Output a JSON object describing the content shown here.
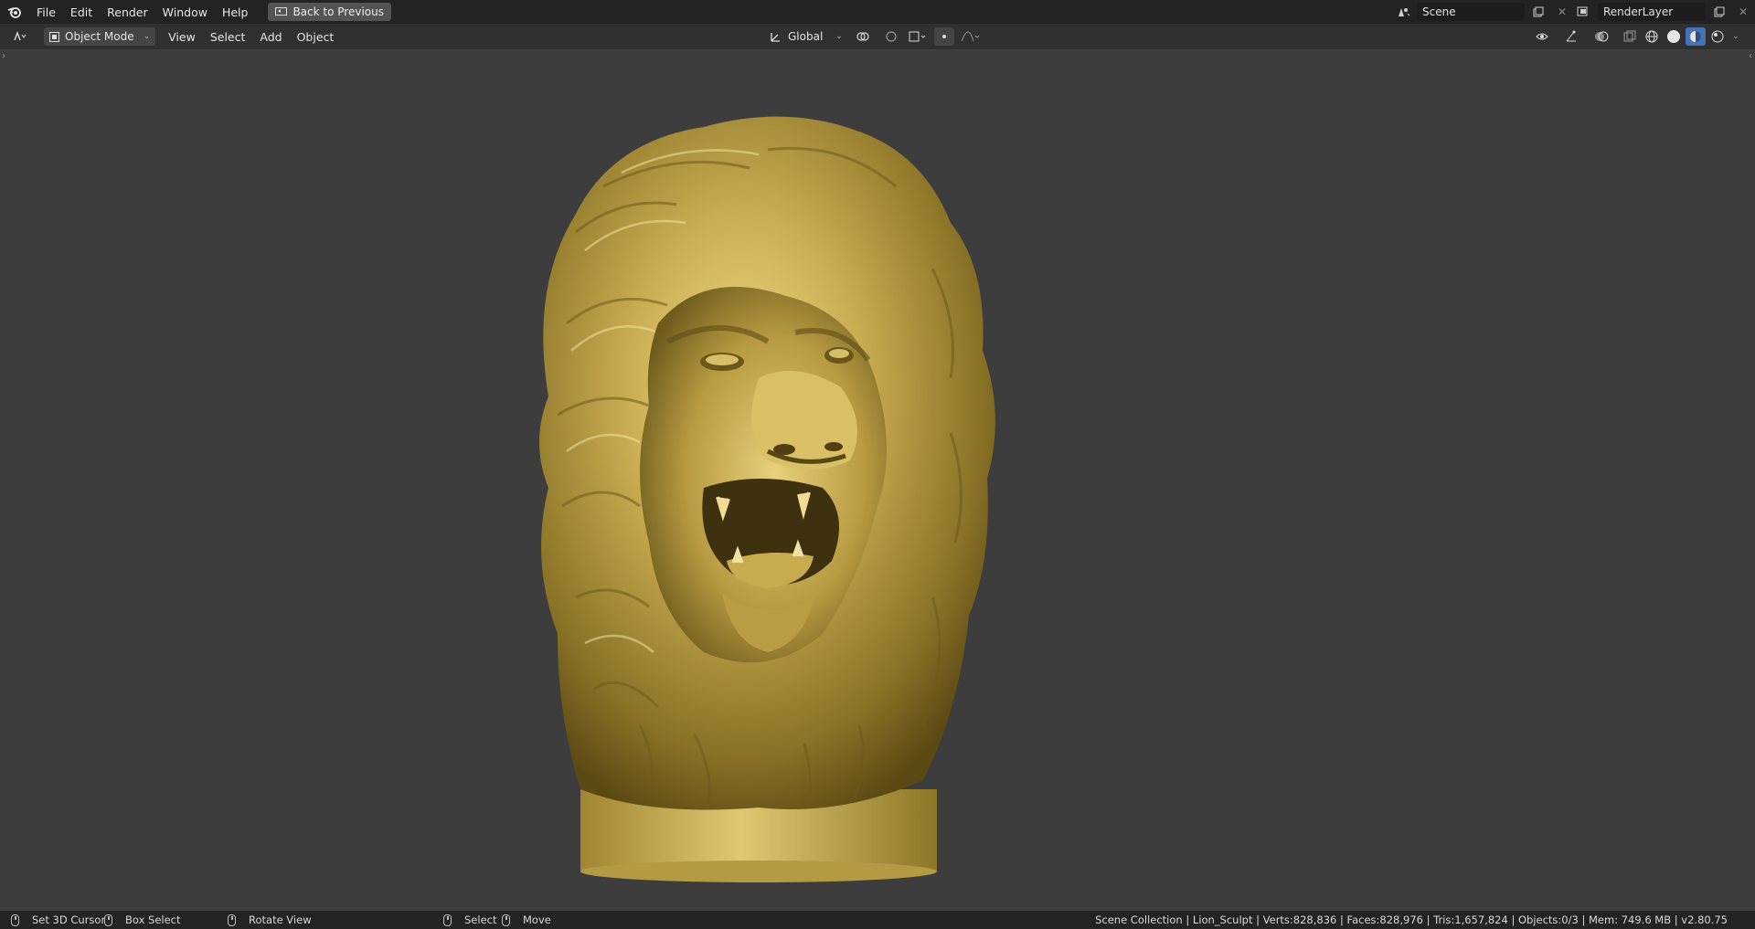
{
  "topbar": {
    "menus": [
      "File",
      "Edit",
      "Render",
      "Window",
      "Help"
    ],
    "back_button": "Back to Previous",
    "scene_name": "Scene",
    "render_layer": "RenderLayer"
  },
  "header": {
    "mode": "Object Mode",
    "menus": [
      "View",
      "Select",
      "Add",
      "Object"
    ],
    "transform_orientation": "Global"
  },
  "statusbar": {
    "set_cursor": "Set 3D Cursor",
    "box_select": "Box Select",
    "rotate_view": "Rotate View",
    "select": "Select",
    "move": "Move",
    "stats": "Scene Collection | Lion_Sculpt | Verts:828,836 | Faces:828,976 | Tris:1,657,824 | Objects:0/3 | Mem: 749.6 MB | v2.80.75"
  },
  "colors": {
    "viewport_bg": "#3d3d3d",
    "topbar_bg": "#232323",
    "header_bg": "#303030",
    "accent_blue": "#4772b3",
    "gold": "#c9ad52"
  },
  "icons": [
    "blender-logo-icon",
    "back-icon",
    "scene-icon",
    "renderlayer-icon",
    "cursor-icon",
    "object-mode-icon",
    "orientation-icon",
    "pivot-icon",
    "snap-icon",
    "proportional-icon",
    "visibility-icon",
    "gizmo-icon",
    "overlay-icon",
    "xray-icon",
    "wireframe-icon",
    "solid-icon",
    "material-icon",
    "rendered-icon"
  ]
}
